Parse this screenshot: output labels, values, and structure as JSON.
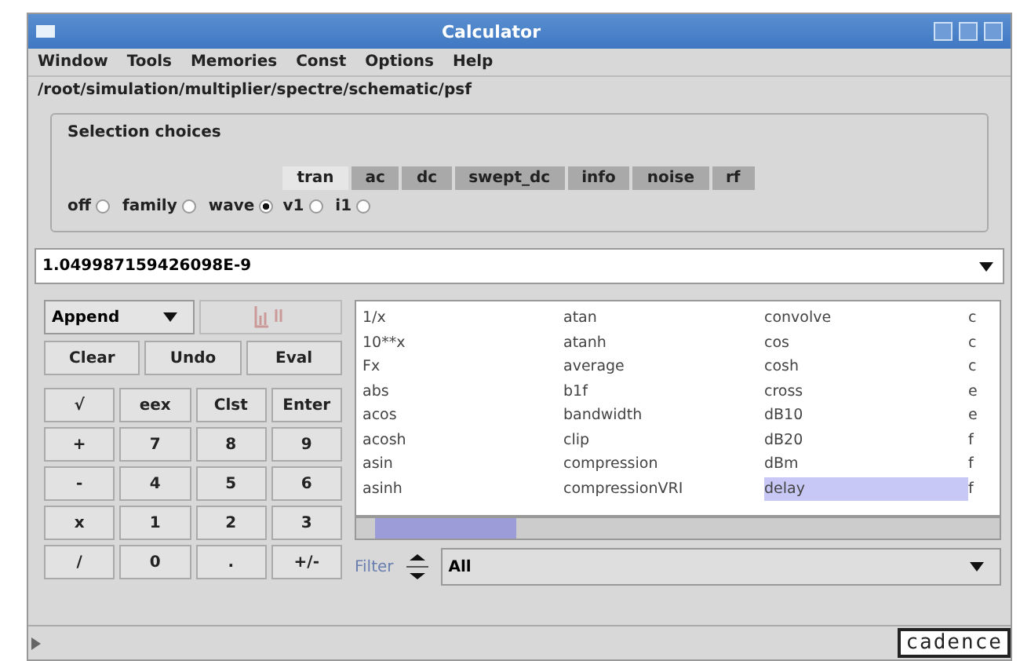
{
  "window": {
    "title": "Calculator"
  },
  "menu": [
    "Window",
    "Tools",
    "Memories",
    "Const",
    "Options",
    "Help"
  ],
  "path": "/root/simulation/multiplier/spectre/schematic/psf",
  "selection": {
    "title": "Selection choices",
    "modes": [
      {
        "label": "off",
        "selected": false
      },
      {
        "label": "family",
        "selected": false
      },
      {
        "label": "wave",
        "selected": true
      }
    ],
    "tabs": [
      {
        "label": "tran",
        "selected": true
      },
      {
        "label": "ac",
        "selected": false
      },
      {
        "label": "dc",
        "selected": false
      },
      {
        "label": "swept_dc",
        "selected": false
      },
      {
        "label": "info",
        "selected": false
      },
      {
        "label": "noise",
        "selected": false
      },
      {
        "label": "rf",
        "selected": false
      }
    ],
    "signals": [
      {
        "label": "v1",
        "selected": false
      },
      {
        "label": "i1",
        "selected": false
      }
    ]
  },
  "value": "1.049987159426098E-9",
  "mode_select": "Append",
  "edit_buttons": [
    "Clear",
    "Undo",
    "Eval"
  ],
  "keys": [
    [
      "√",
      "eex",
      "Clst",
      "Enter"
    ],
    [
      "+",
      "7",
      "8",
      "9"
    ],
    [
      "-",
      "4",
      "5",
      "6"
    ],
    [
      "x",
      "1",
      "2",
      "3"
    ],
    [
      "/",
      "0",
      ".",
      "+/-"
    ]
  ],
  "functions": [
    [
      {
        "label": "1/x",
        "selected": false
      },
      {
        "label": "10**x",
        "selected": false
      },
      {
        "label": "Fx",
        "selected": false
      },
      {
        "label": "abs",
        "selected": false
      },
      {
        "label": "acos",
        "selected": false
      },
      {
        "label": "acosh",
        "selected": false
      },
      {
        "label": "asin",
        "selected": false
      },
      {
        "label": "asinh",
        "selected": false
      }
    ],
    [
      {
        "label": "atan",
        "selected": false
      },
      {
        "label": "atanh",
        "selected": false
      },
      {
        "label": "average",
        "selected": false
      },
      {
        "label": "b1f",
        "selected": false
      },
      {
        "label": "bandwidth",
        "selected": false
      },
      {
        "label": "clip",
        "selected": false
      },
      {
        "label": "compression",
        "selected": false
      },
      {
        "label": "compressionVRI",
        "selected": false
      }
    ],
    [
      {
        "label": "convolve",
        "selected": false
      },
      {
        "label": "cos",
        "selected": false
      },
      {
        "label": "cosh",
        "selected": false
      },
      {
        "label": "cross",
        "selected": false
      },
      {
        "label": "dB10",
        "selected": false
      },
      {
        "label": "dB20",
        "selected": false
      },
      {
        "label": "dBm",
        "selected": false
      },
      {
        "label": "delay",
        "selected": true
      }
    ],
    [
      {
        "label": "c",
        "selected": false
      },
      {
        "label": "c",
        "selected": false
      },
      {
        "label": "c",
        "selected": false
      },
      {
        "label": "e",
        "selected": false
      },
      {
        "label": "e",
        "selected": false
      },
      {
        "label": "f",
        "selected": false
      },
      {
        "label": "f",
        "selected": false
      },
      {
        "label": "f",
        "selected": false
      }
    ]
  ],
  "filter": {
    "label": "Filter",
    "value": "All"
  },
  "logo": "cadence"
}
